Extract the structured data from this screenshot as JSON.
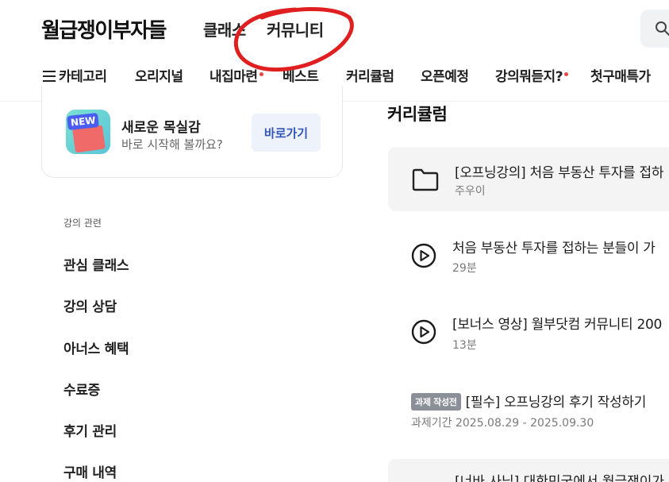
{
  "header": {
    "logo": "월급쟁이부자들",
    "nav": [
      "클래스",
      "커뮤니티"
    ]
  },
  "subnav": {
    "category": "카테고리",
    "items": [
      "오리지널",
      "내집마련",
      "베스트",
      "커리큘럼",
      "오픈예정",
      "강의뭐듣지?",
      "첫구매특가"
    ]
  },
  "promo_card": {
    "badge": "NEW",
    "title": "새로운 목실감",
    "subtitle": "바로 시작해 볼까요?",
    "button": "바로가기"
  },
  "sidebar": {
    "section": "강의 관련",
    "items": [
      "관심 클래스",
      "강의 상담",
      "아너스 혜택",
      "수료증",
      "후기 관리",
      "구매 내역"
    ]
  },
  "curriculum": {
    "title": "커리큘럼",
    "folder": {
      "title": "[오프닝강의] 처음 부동산 투자를 접하",
      "author": "주우이"
    },
    "videos": [
      {
        "title": "처음 부동산 투자를 접하는 분들이 가",
        "duration": "29분"
      },
      {
        "title": "[보너스 영상] 월부닷컴 커뮤니티 200",
        "duration": "13분"
      }
    ],
    "task": {
      "badge": "과제 작성전",
      "title": "[필수] 오프닝강의 후기 작성하기",
      "period": "과제기간 2025.08.29 - 2025.09.30"
    },
    "next": "[너바 사님] 대한민국에서 월급쟁이가"
  },
  "colors": {
    "accent": "#3556b8",
    "annotation": "#e02020"
  }
}
